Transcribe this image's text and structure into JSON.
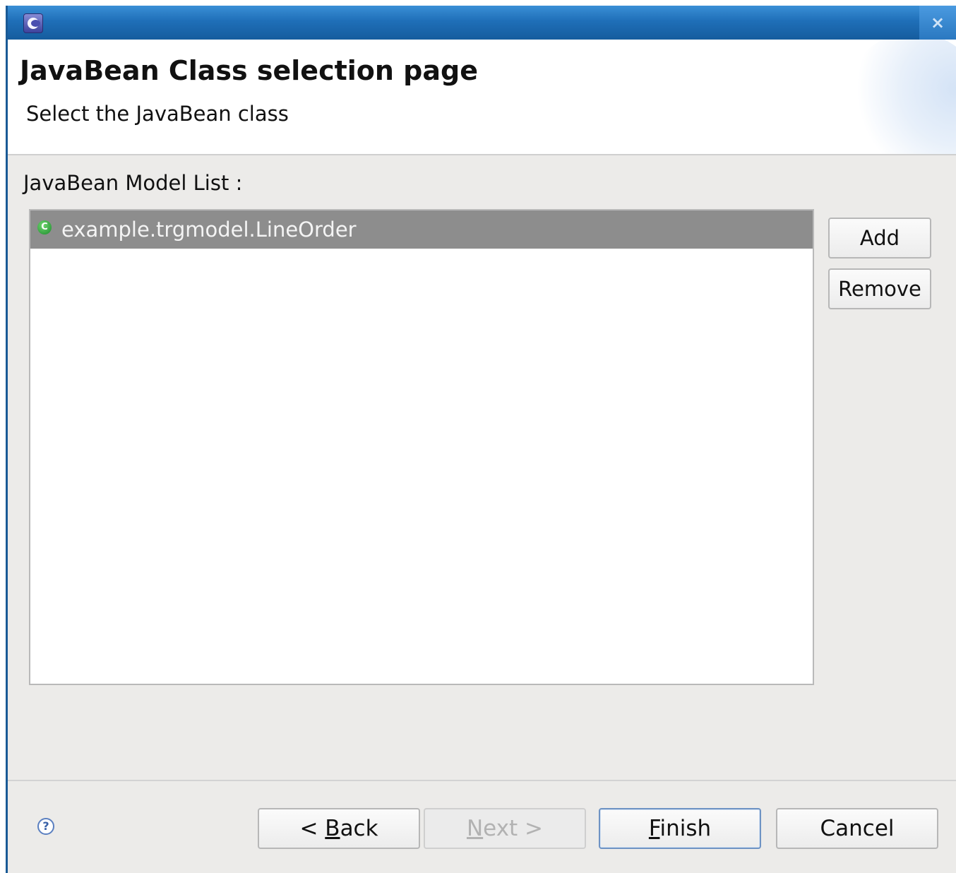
{
  "window": {
    "icon": "eclipse-icon",
    "close": "×"
  },
  "header": {
    "title": "JavaBean Class selection page",
    "subtitle": "Select the JavaBean class"
  },
  "model_list": {
    "label": "JavaBean Model List :",
    "items": [
      {
        "label": "example.trgmodel.LineOrder",
        "icon": "class-icon",
        "selected": true
      }
    ]
  },
  "side_buttons": {
    "add": "Add",
    "remove": "Remove"
  },
  "footer": {
    "help_icon": "?",
    "back_prefix": "< ",
    "back_mnemonic": "B",
    "back_rest": "ack",
    "next_mnemonic": "N",
    "next_rest": "ext >",
    "finish_mnemonic": "F",
    "finish_rest": "inish",
    "cancel": "Cancel"
  },
  "colors": {
    "titlebar": "#1f6fb8",
    "selection": "#8d8d8d",
    "dialog_bg": "#ecebe9"
  }
}
